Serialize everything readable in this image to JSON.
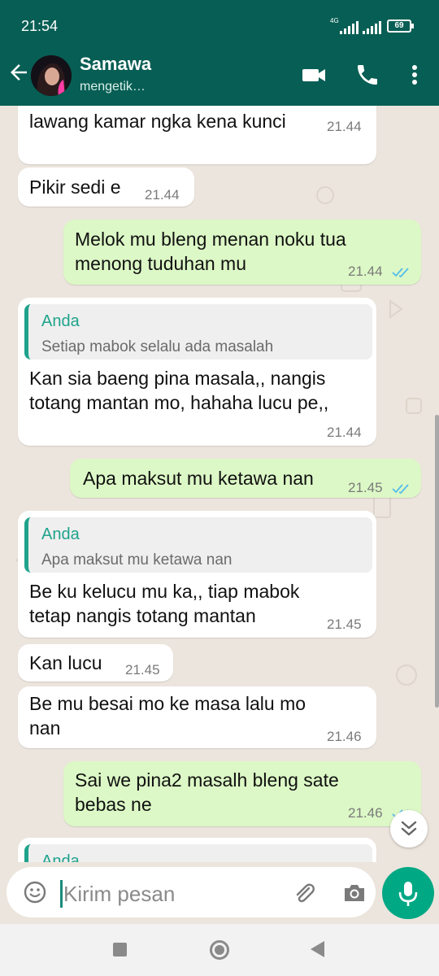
{
  "status_bar": {
    "time": "21:54",
    "network": "4G",
    "battery": "69"
  },
  "header": {
    "contact_name": "Samawa",
    "contact_status": "mengetik…"
  },
  "messages": [
    {
      "dir": "in",
      "text": "lawang kamar ngka kena kunci",
      "time": "21.44"
    },
    {
      "dir": "in",
      "text": "Pikir sedi e",
      "time": "21.44"
    },
    {
      "dir": "out",
      "text": "Melok mu bleng menan noku tua\nmenong tuduhan mu",
      "time": "21.44",
      "read": true
    },
    {
      "dir": "in",
      "quote_author": "Anda",
      "quote_text": "Setiap mabok selalu ada masalah",
      "text": "Kan sia baeng pina masala,, nangis\ntotang mantan mo, hahaha lucu pe,,",
      "time": "21.44"
    },
    {
      "dir": "out",
      "text": "Apa maksut mu ketawa nan",
      "time": "21.45",
      "read": true
    },
    {
      "dir": "in",
      "quote_author": "Anda",
      "quote_text": "Apa maksut mu ketawa nan",
      "text": "Be ku kelucu mu ka,, tiap mabok\ntetap nangis totang mantan",
      "time": "21.45"
    },
    {
      "dir": "in",
      "text": "Kan lucu",
      "time": "21.45"
    },
    {
      "dir": "in",
      "text": "Be mu besai mo ke masa lalu mo\nnan",
      "time": "21.46"
    },
    {
      "dir": "out",
      "text": "Sai we pina2 masalh bleng sate\nbebas ne",
      "time": "21.46",
      "read": true
    },
    {
      "dir": "in",
      "quote_author": "Anda"
    }
  ],
  "composer": {
    "placeholder": "Kirim pesan"
  },
  "colors": {
    "header": "#075e54",
    "outgoing": "#dcf8c6",
    "incoming": "#ffffff",
    "accent": "#00a884",
    "quote_accent": "#1fa38c",
    "read_tick": "#53bdeb"
  }
}
